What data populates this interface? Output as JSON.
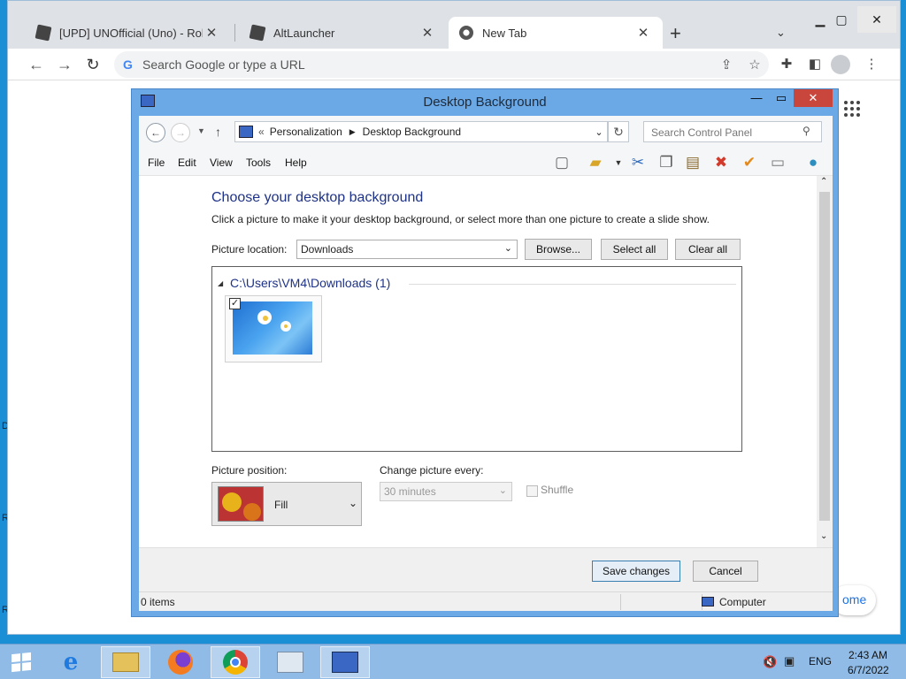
{
  "browser": {
    "tabs": [
      {
        "label": "[UPD] UNOfficial (Uno) - Roblox",
        "icon": "roblox-icon"
      },
      {
        "label": "AltLauncher",
        "icon": "roblox-icon"
      },
      {
        "label": "New Tab",
        "icon": "chrome-icon",
        "active": true
      }
    ],
    "new_tab_glyph": "+",
    "omnibox_placeholder": "Search Google or type a URL",
    "customize_partial": "ome"
  },
  "desktop_edge_glyphs": [
    "D",
    "R",
    "R"
  ],
  "window": {
    "title": "Desktop Background",
    "breadcrumb_prefix": "«",
    "breadcrumb": [
      "Personalization",
      "Desktop Background"
    ],
    "search_placeholder": "Search Control Panel",
    "menu": [
      "File",
      "Edit",
      "View",
      "Tools",
      "Help"
    ]
  },
  "content": {
    "heading": "Choose your desktop background",
    "instructions": "Click a picture to make it your desktop background, or select more than one picture to create a slide show.",
    "picture_location_label": "Picture location:",
    "picture_location_value": "Downloads",
    "browse_label": "Browse...",
    "select_all_label": "Select all",
    "clear_all_label": "Clear all",
    "group_header": "C:\\Users\\VM4\\Downloads (1)",
    "thumbnail_checked": true,
    "picture_position_label": "Picture position:",
    "picture_position_value": "Fill",
    "change_every_label": "Change picture every:",
    "change_every_value": "30 minutes",
    "shuffle_label": "Shuffle"
  },
  "footer": {
    "save_label": "Save changes",
    "cancel_label": "Cancel"
  },
  "status": {
    "items": "0 items",
    "location": "Computer"
  },
  "taskbar": {
    "apps": [
      "start-icon",
      "internet-explorer-icon",
      "file-explorer-icon",
      "firefox-icon",
      "chrome-icon",
      "performance-monitor-icon",
      "control-panel-icon"
    ],
    "language": "ENG",
    "time": "2:43 AM",
    "date": "6/7/2022"
  },
  "colors": {
    "desktop": "#1a8fd6",
    "window_frame": "#6ba8e6",
    "close_button": "#c9463d",
    "taskbar": "#8fbbe6",
    "heading": "#1e3287"
  }
}
